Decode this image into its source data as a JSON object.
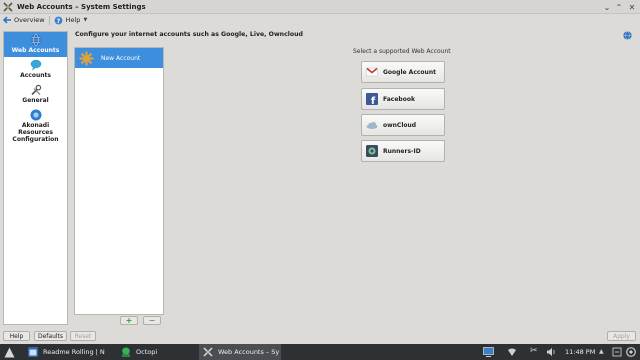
{
  "window": {
    "title": "Web Accounts – System Settings"
  },
  "toolbar": {
    "overview": "Overview",
    "help": "Help"
  },
  "sidebar": {
    "items": [
      {
        "label": "Web Accounts",
        "icon": "globe-icon",
        "active": true
      },
      {
        "label": "Accounts",
        "icon": "speech-bubble-icon",
        "active": false
      },
      {
        "label": "General",
        "icon": "tools-icon",
        "active": false
      },
      {
        "label": "Akonadi Resources Configuration",
        "icon": "akonadi-icon",
        "active": false
      }
    ]
  },
  "header": {
    "text": "Configure your internet accounts such as Google, Live, Owncloud"
  },
  "accounts": {
    "items": [
      {
        "label": "New Account"
      }
    ],
    "add": "+",
    "remove": "−"
  },
  "services": {
    "title": "Select a supported Web Account",
    "items": [
      {
        "label": "Google Account",
        "icon": "gmail-icon"
      },
      {
        "label": "Facebook",
        "icon": "facebook-icon"
      },
      {
        "label": "ownCloud",
        "icon": "owncloud-icon"
      },
      {
        "label": "Runners-ID",
        "icon": "runners-id-icon"
      }
    ]
  },
  "footer": {
    "help": "Help",
    "defaults": "Defaults",
    "reset": "Reset",
    "apply": "Apply"
  },
  "taskbar": {
    "tasks": [
      {
        "label": "Readme Rolling | N"
      },
      {
        "label": "Octopi"
      },
      {
        "label": "Web Accounts – Sy"
      }
    ],
    "clock": "11:48 PM"
  },
  "colors": {
    "accent": "#3e8ede",
    "taskbar": "#2e3133"
  }
}
